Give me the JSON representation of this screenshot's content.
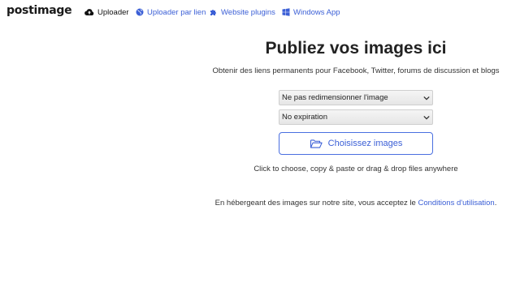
{
  "header": {
    "logo": "postimage",
    "nav": [
      {
        "label": "Uploader",
        "icon": "cloud-upload-icon"
      },
      {
        "label": "Uploader par lien",
        "icon": "globe-icon"
      },
      {
        "label": "Website plugins",
        "icon": "puzzle-icon"
      },
      {
        "label": "Windows App",
        "icon": "windows-icon"
      }
    ]
  },
  "main": {
    "title": "Publiez vos images ici",
    "subtitle": "Obtenir des liens permanents pour Facebook, Twitter, forums de discussion et blogs",
    "resize_select": {
      "selected": "Ne pas redimensionner l'image"
    },
    "expiration_select": {
      "selected": "No expiration"
    },
    "choose_button": {
      "label": "Choisissez images",
      "icon": "folder-open-icon"
    },
    "hint": "Click to choose, copy & paste or drag & drop files anywhere",
    "terms_prefix": "En hébergeant des images sur notre site, vous acceptez le ",
    "terms_link": "Conditions d'utilisation",
    "terms_suffix": "."
  },
  "colors": {
    "accent": "#3b5fd6",
    "text": "#222222"
  }
}
